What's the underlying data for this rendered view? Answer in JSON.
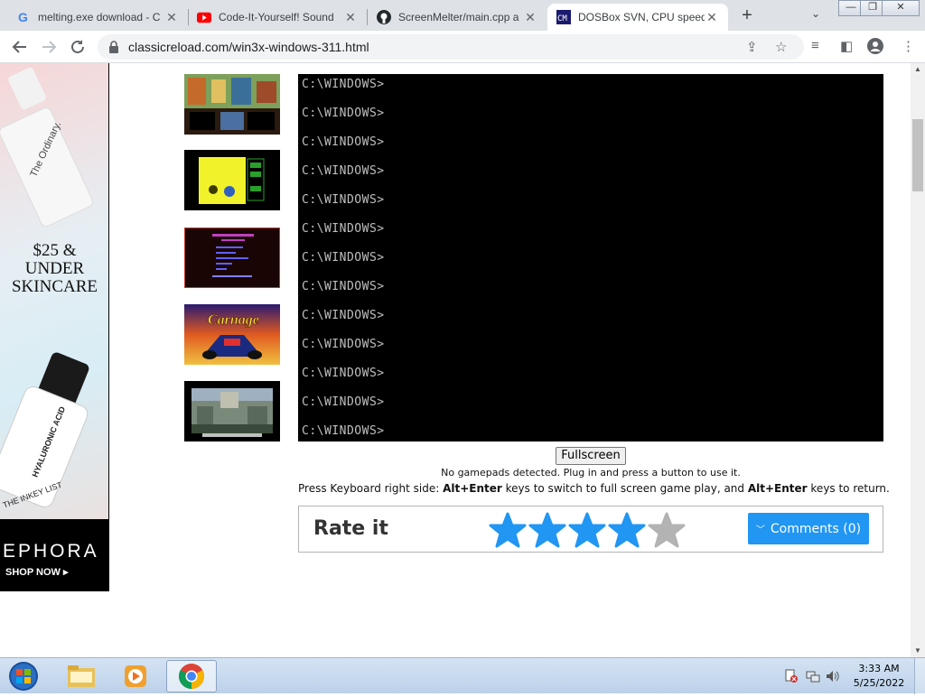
{
  "browser": {
    "tabs": [
      {
        "title": "melting.exe download - C",
        "icon": "google-icon"
      },
      {
        "title": "Code-It-Yourself! Sound",
        "icon": "youtube-icon"
      },
      {
        "title": "ScreenMelter/main.cpp a",
        "icon": "github-icon"
      },
      {
        "title": "DOSBox SVN, CPU speed",
        "icon": "dosbox-icon",
        "active": true
      }
    ],
    "new_tab": "+",
    "tab_search": "⌄",
    "window_controls": {
      "minimize": "—",
      "restore": "❐",
      "close": "✕"
    },
    "url": "classicreload.com/win3x-windows-311.html"
  },
  "ad": {
    "headline": [
      "$25 &",
      "UNDER",
      "SKINCARE"
    ],
    "product1_brand": "The Ordinary.",
    "product2_label": "HYALURONIC ACID",
    "product2_brand": "THE INKEY LIST",
    "brand": "SEPHORA",
    "cta": "SHOP NOW ▸"
  },
  "dos": {
    "prompt": "C:\\WINDOWS>",
    "line_count": 13
  },
  "fullscreen_button": "Fullscreen",
  "gamepad_message": "No gamepads detected. Plug in and press a button to use it.",
  "keyhint": {
    "prefix": "Press Keyboard right side: ",
    "key1": "Alt+Enter",
    "middle": " keys to switch to full screen game play, and ",
    "key2": "Alt+Enter",
    "suffix": " keys to return."
  },
  "rating": {
    "title": "Rate it",
    "value": 4,
    "max": 5,
    "filled_color": "#2196f3",
    "empty_color": "#b3b3b3"
  },
  "comments_button": "Comments (0)",
  "taskbar": {
    "time": "3:33 AM",
    "date": "5/25/2022"
  }
}
